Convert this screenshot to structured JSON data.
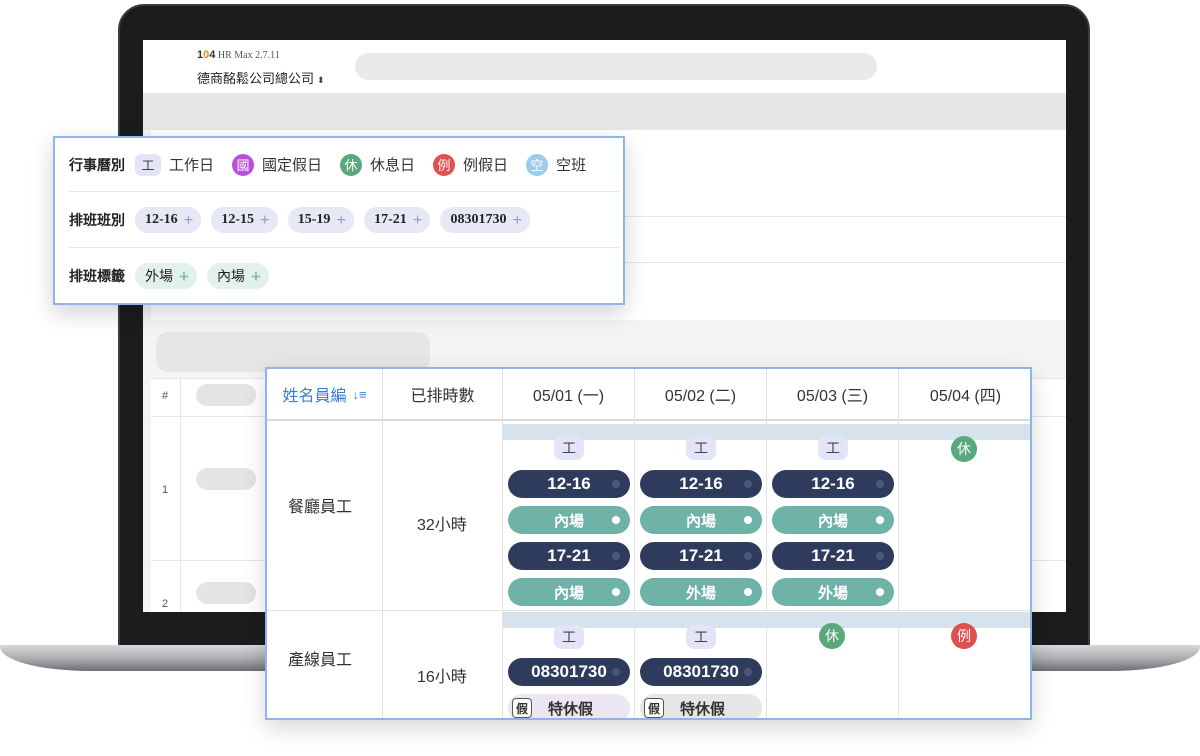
{
  "app": {
    "logo_prefix": "1",
    "logo_o": "0",
    "logo_suffix": "4",
    "product": " HR Max 2.7.11",
    "company": "德商酩鬆公司總公司",
    "company_caret": "⬍"
  },
  "legend": {
    "calendar_title": "行事曆別",
    "calendar_items": [
      {
        "badge": "工",
        "label": "工作日",
        "type": "work"
      },
      {
        "badge": "國",
        "label": "國定假日",
        "type": "national-holiday"
      },
      {
        "badge": "休",
        "label": "休息日",
        "type": "rest-day"
      },
      {
        "badge": "例",
        "label": "例假日",
        "type": "regular-holiday"
      },
      {
        "badge": "空",
        "label": "空班",
        "type": "empty-shift"
      }
    ],
    "shift_title": "排班班別",
    "shifts": [
      "12-16",
      "12-15",
      "15-19",
      "17-21",
      "08301730"
    ],
    "tag_title": "排班標籤",
    "tags": [
      "外場",
      "內場"
    ],
    "add_symbol": "+"
  },
  "background_table": {
    "hash_header": "#",
    "row_numbers": [
      "1",
      "2"
    ]
  },
  "schedule": {
    "headers": {
      "name": "姓名員編",
      "sort_icon": "↓≡",
      "hours": "已排時數",
      "dates": [
        "05/01 (一)",
        "05/02 (二)",
        "05/03 (三)",
        "05/04 (四)"
      ]
    },
    "rows": [
      {
        "name": "餐廳員工",
        "hours": "32小時",
        "days": [
          {
            "badge": "工",
            "entries": [
              {
                "kind": "shift",
                "text": "12-16"
              },
              {
                "kind": "tag",
                "text": "內場"
              },
              {
                "kind": "shift",
                "text": "17-21"
              },
              {
                "kind": "tag",
                "text": "內場"
              }
            ]
          },
          {
            "badge": "工",
            "entries": [
              {
                "kind": "shift",
                "text": "12-16"
              },
              {
                "kind": "tag",
                "text": "內場"
              },
              {
                "kind": "shift",
                "text": "17-21"
              },
              {
                "kind": "tag",
                "text": "外場"
              }
            ]
          },
          {
            "badge": "工",
            "entries": [
              {
                "kind": "shift",
                "text": "12-16"
              },
              {
                "kind": "tag",
                "text": "內場"
              },
              {
                "kind": "shift",
                "text": "17-21"
              },
              {
                "kind": "tag",
                "text": "外場"
              }
            ]
          },
          {
            "badge": "休",
            "entries": []
          }
        ]
      },
      {
        "name": "產線員工",
        "hours": "16小時",
        "days": [
          {
            "badge": "工",
            "entries": [
              {
                "kind": "shift",
                "text": "08301730"
              },
              {
                "kind": "leave",
                "icon": "假",
                "text": "特休假"
              }
            ]
          },
          {
            "badge": "工",
            "entries": [
              {
                "kind": "shift",
                "text": "08301730"
              },
              {
                "kind": "leave",
                "icon": "假",
                "text": "特休假"
              }
            ]
          },
          {
            "badge": "休",
            "entries": []
          },
          {
            "badge": "例",
            "entries": []
          }
        ]
      }
    ]
  },
  "colors": {
    "accent_blue": "#3e7bd6",
    "shift_navy": "#2f3b5c",
    "tag_teal": "#6fb2a7",
    "rest_green": "#5aa87c",
    "regular_red": "#e0504f",
    "national_purple": "#b84fd8",
    "empty_lightblue": "#9ccbeb"
  }
}
